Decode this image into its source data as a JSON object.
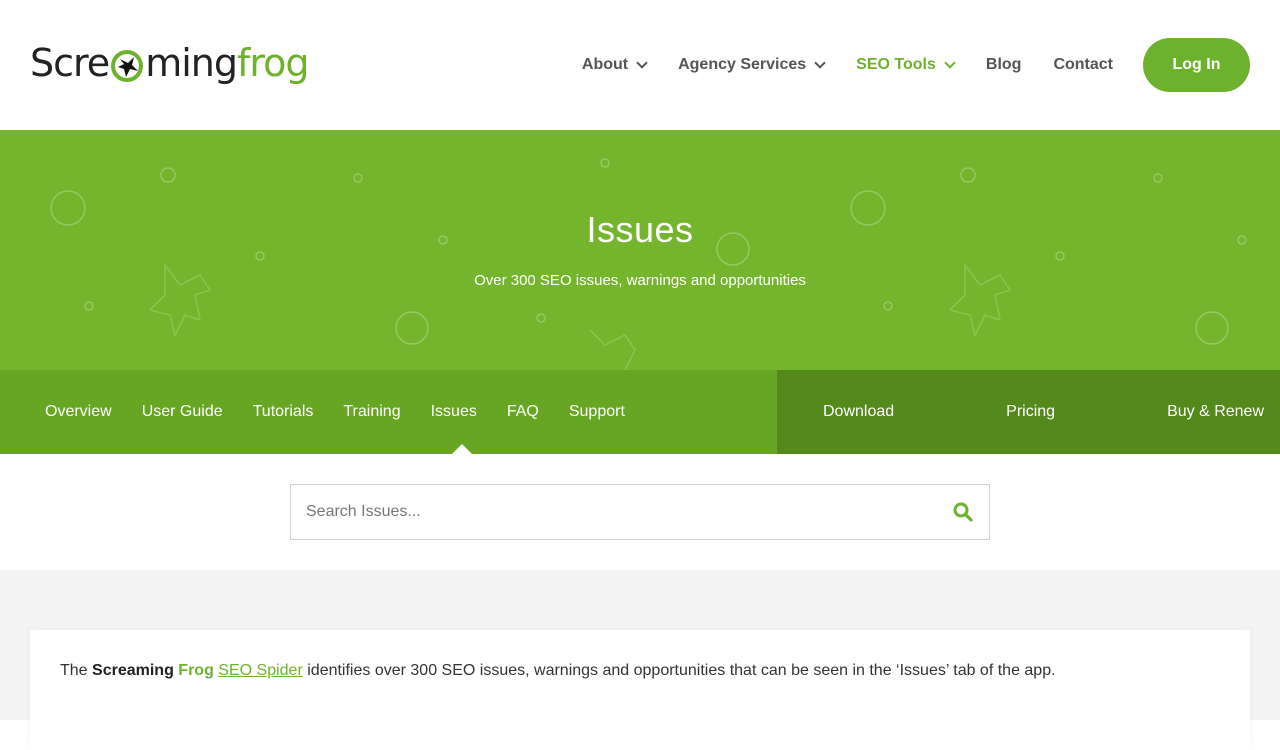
{
  "logo": {
    "part1": "Scre",
    "part2": "ming",
    "part3": "frog"
  },
  "topnav": {
    "items": [
      {
        "label": "About"
      },
      {
        "label": "Agency Services"
      },
      {
        "label": "SEO Tools"
      },
      {
        "label": "Blog"
      },
      {
        "label": "Contact"
      }
    ],
    "login_label": "Log In",
    "accent": "#6db22c"
  },
  "hero": {
    "title": "Issues",
    "subtitle": "Over 300 SEO issues, warnings and opportunities",
    "background": "#75b52d"
  },
  "subnav": {
    "left": [
      "Overview",
      "User Guide",
      "Tutorials",
      "Training",
      "Issues",
      "FAQ",
      "Support"
    ],
    "right": [
      "Download",
      "Pricing",
      "Buy & Renew"
    ],
    "active": "Issues"
  },
  "search": {
    "placeholder": "Search Issues..."
  },
  "intro": {
    "the": "The",
    "brand_dark": "Screaming",
    "brand_green": "Frog",
    "link": "SEO Spider",
    "rest": "identifies over 300 SEO issues, warnings and opportunities that can be seen in the ‘Issues’ tab of the app."
  }
}
